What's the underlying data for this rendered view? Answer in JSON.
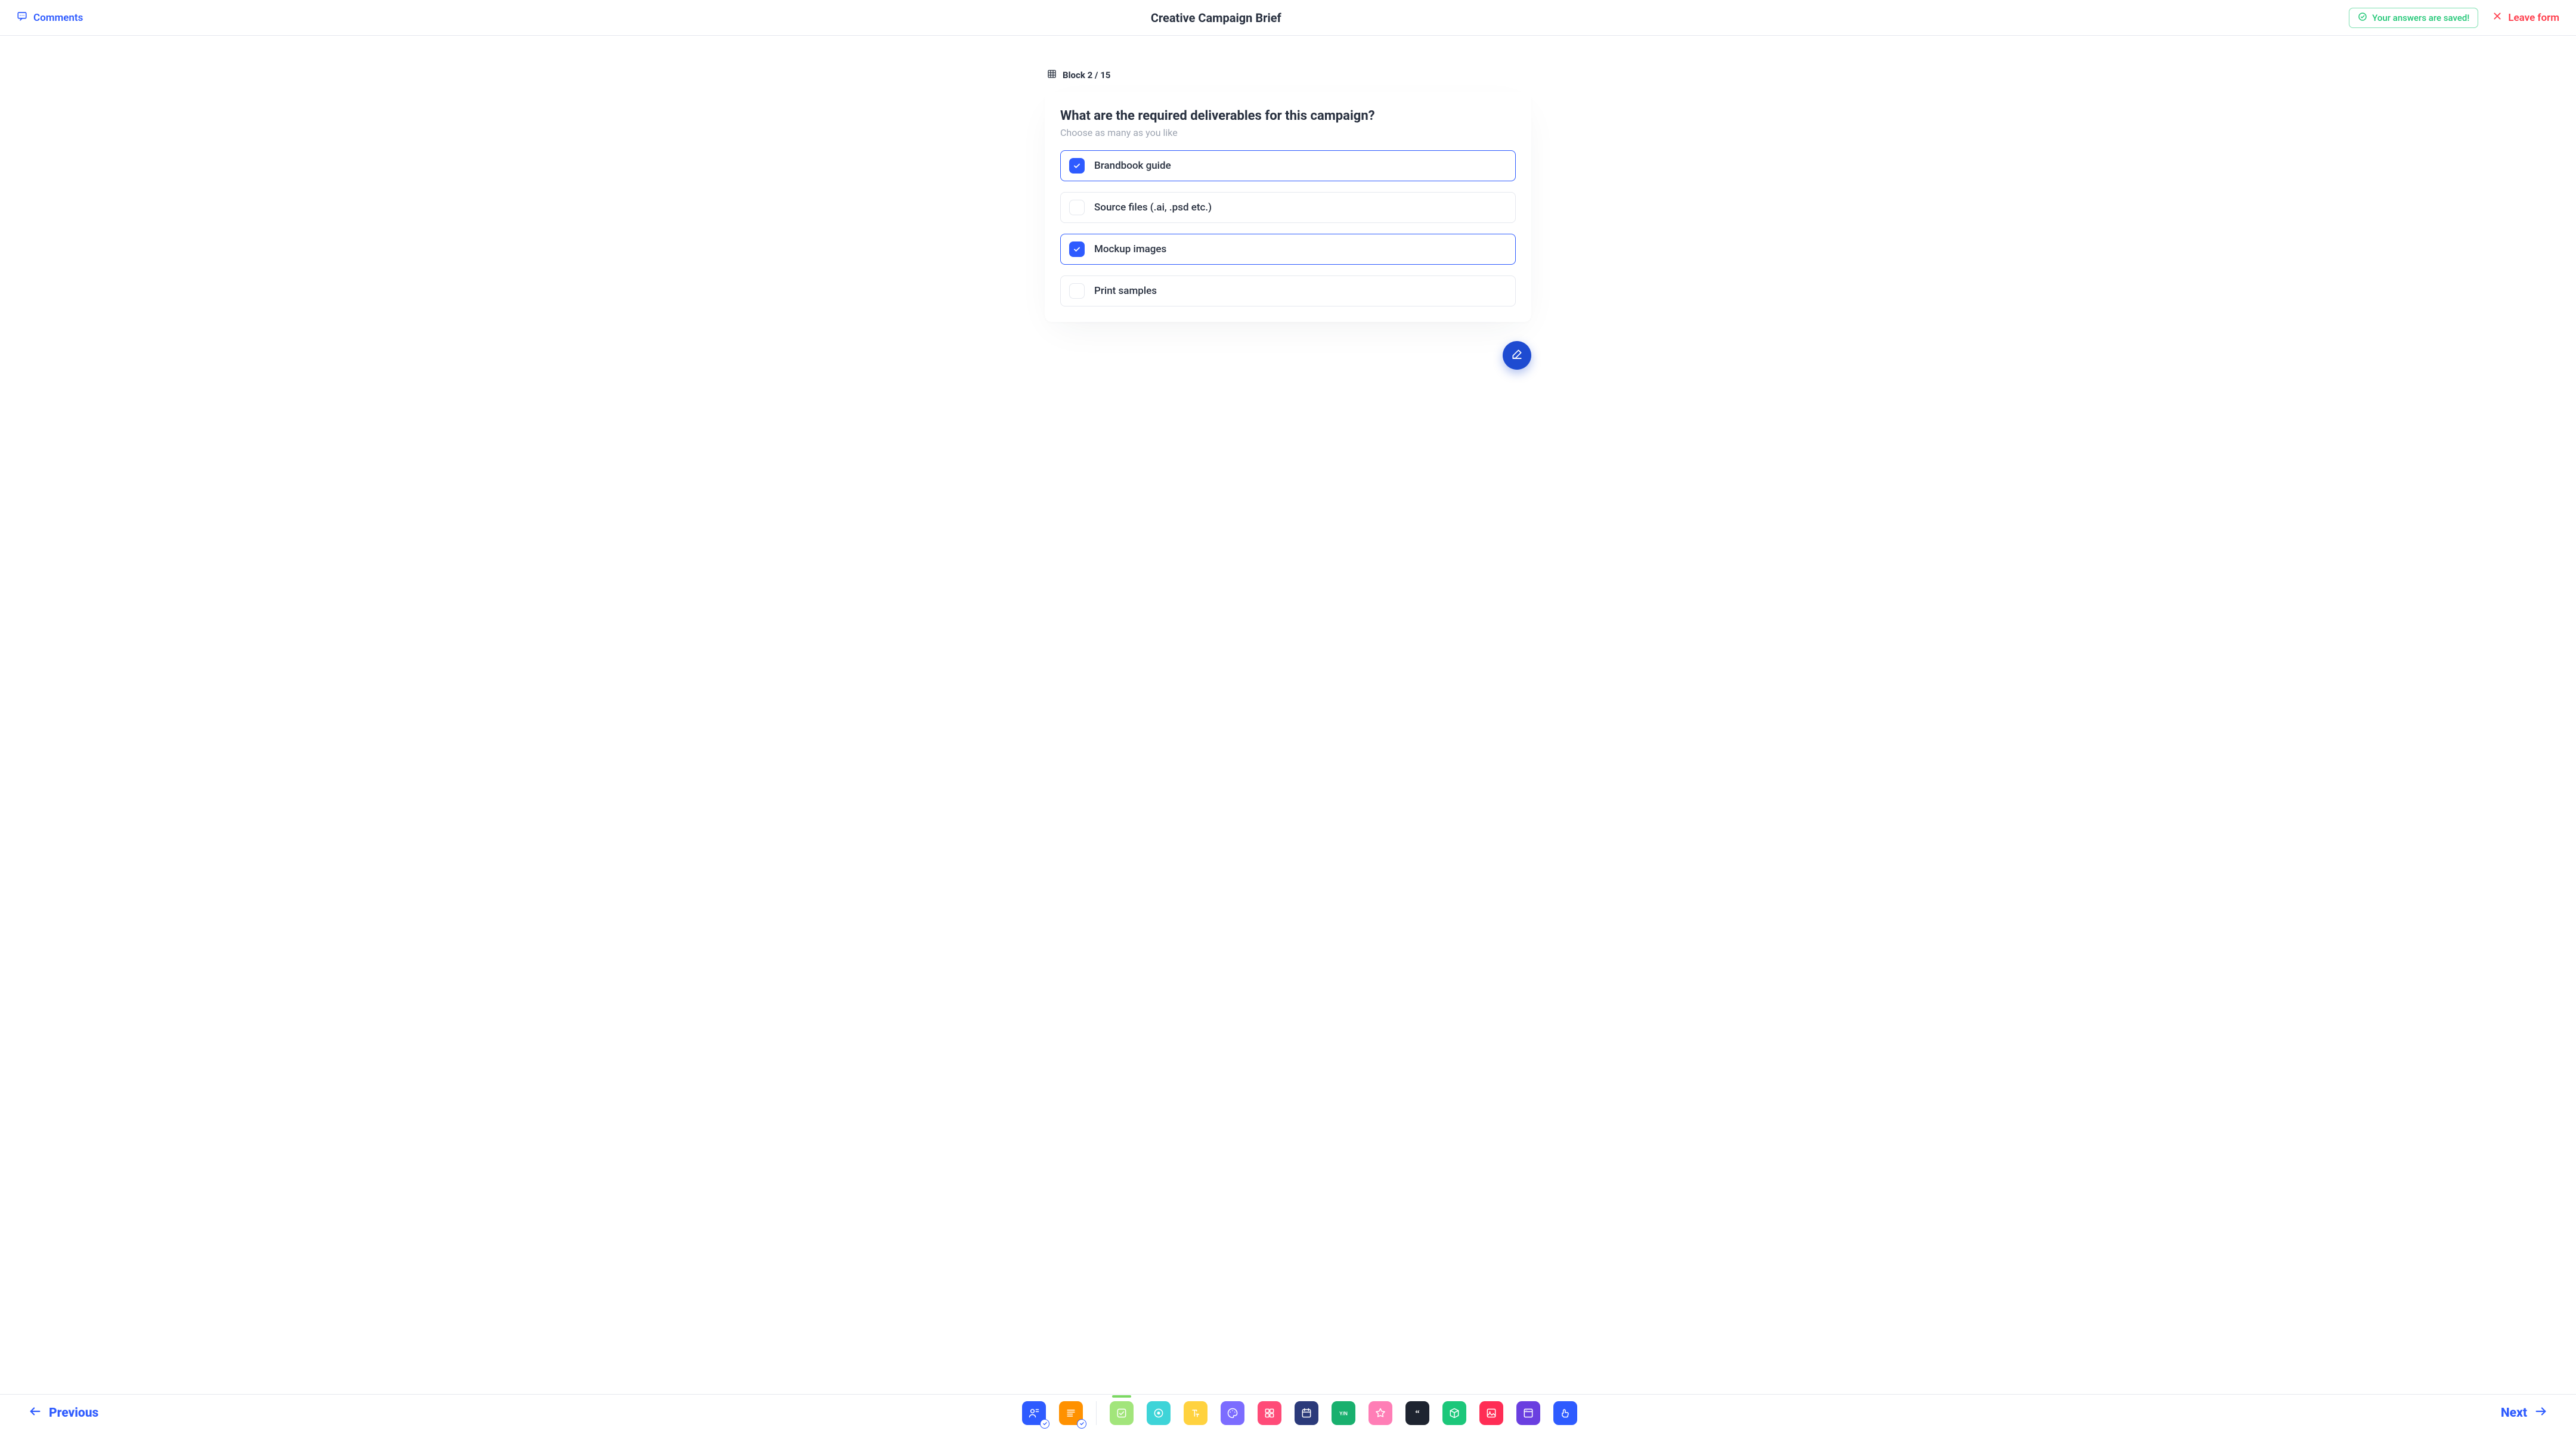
{
  "header": {
    "comments_label": "Comments",
    "title": "Creative Campaign Brief",
    "saved_label": "Your answers are saved!",
    "leave_label": "Leave form"
  },
  "block_indicator": {
    "prefix": "Block",
    "current": 2,
    "total": 15,
    "text": "Block 2 / 15"
  },
  "question": {
    "title": "What are the required deliverables for this campaign?",
    "hint": "Choose as many as you like",
    "options": [
      {
        "label": "Brandbook guide",
        "selected": true
      },
      {
        "label": "Source files (.ai, .psd etc.)",
        "selected": false
      },
      {
        "label": "Mockup images",
        "selected": true
      },
      {
        "label": "Print samples",
        "selected": false
      }
    ]
  },
  "footer": {
    "prev_label": "Previous",
    "next_label": "Next",
    "blocks": [
      {
        "name": "contact",
        "color": "#2E5BFF",
        "done": true,
        "active": false
      },
      {
        "name": "article",
        "color": "#FF9100",
        "done": true,
        "active": false
      },
      {
        "name": "checkbox",
        "color": "#A2E57B",
        "done": false,
        "active": true
      },
      {
        "name": "radio",
        "color": "#3ED4D8",
        "done": false,
        "active": false
      },
      {
        "name": "text",
        "color": "#FFD23F",
        "done": false,
        "active": false
      },
      {
        "name": "color",
        "color": "#7C6CFF",
        "done": false,
        "active": false
      },
      {
        "name": "grid",
        "color": "#FF4B78",
        "done": false,
        "active": false
      },
      {
        "name": "calendar",
        "color": "#2B3A7A",
        "done": false,
        "active": false
      },
      {
        "name": "yesno",
        "color": "#19B06E",
        "done": false,
        "active": false
      },
      {
        "name": "rating",
        "color": "#FF7EB6",
        "done": false,
        "active": false
      },
      {
        "name": "quote",
        "color": "#1E2430",
        "done": false,
        "active": false
      },
      {
        "name": "package",
        "color": "#1CC77A",
        "done": false,
        "active": false
      },
      {
        "name": "image",
        "color": "#FF2D55",
        "done": false,
        "active": false
      },
      {
        "name": "website",
        "color": "#6A3FE0",
        "done": false,
        "active": false
      },
      {
        "name": "thanks",
        "color": "#2E5BFF",
        "done": false,
        "active": false
      }
    ]
  }
}
